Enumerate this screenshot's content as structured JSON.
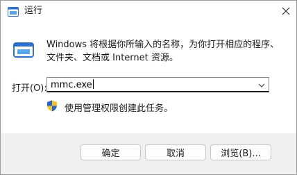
{
  "window": {
    "title": "运行"
  },
  "description": "Windows 将根据你所输入的名称，为你打开相应的程序、文件夹、文档或 Internet 资源。",
  "open_label": "打开(O):",
  "command_input": {
    "value": "mmc.exe"
  },
  "admin_note": "使用管理权限创建此任务。",
  "buttons": {
    "ok": "确定",
    "cancel": "取消",
    "browse": "浏览(B)..."
  },
  "icons": {
    "app": "run-app-icon",
    "run": "run-icon",
    "shield": "uac-shield-icon",
    "dropdown": "chevron-down-icon",
    "close": "close-icon"
  },
  "colors": {
    "accent": "#1a73c9",
    "shield_blue": "#2a66c9",
    "shield_yellow": "#f2c12e"
  }
}
